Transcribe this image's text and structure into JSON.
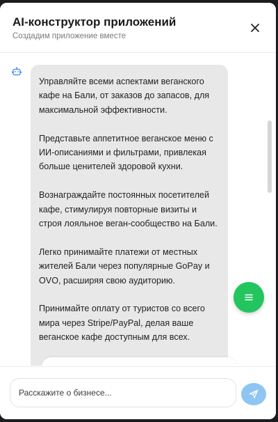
{
  "header": {
    "title": "AI-конструктор приложений",
    "subtitle": "Создадим приложение вместе",
    "close_icon": "close-icon"
  },
  "chat": {
    "bot_icon": "robot-icon",
    "message": {
      "paragraphs": [
        "Управляйте всеми аспектами веганского кафе на Бали, от заказов до запасов, для максимальной эффективности.",
        "Представьте аппетитное веганское меню с ИИ-описаниями и фильтрами, привлекая больше ценителей здоровой кухни.",
        "Вознаграждайте постоянных посетителей кафе, стимулируя повторные визиты и строя лояльное веган-сообщество на Бали.",
        "Легко принимайте платежи от местных жителей Бали через популярные GoPay и OVO, расширяя свою аудиторию.",
        "Принимайте оплату от туристов со всего мира через Stripe/PayPal, делая ваше веганское кафе доступным для всех."
      ]
    },
    "menu_icon": "menu-icon"
  },
  "composer": {
    "placeholder": "Расскажите о бизнесе...",
    "value": "",
    "send_icon": "send-icon"
  },
  "colors": {
    "accent_green": "#22c55e",
    "send_blue": "#8ec5f2",
    "bubble_bg": "#e8e8e9"
  }
}
